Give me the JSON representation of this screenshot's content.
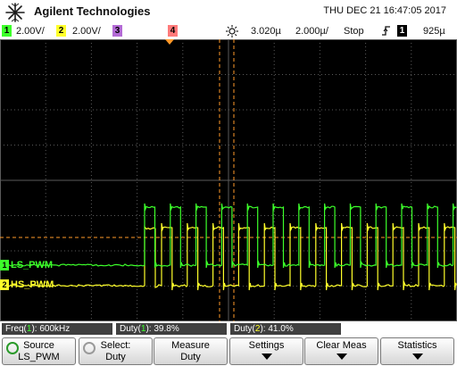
{
  "header": {
    "brand": "Agilent Technologies",
    "datetime": "THU DEC 21 16:47:05 2017"
  },
  "status": {
    "ch1_number": "1",
    "ch1_scale": "2.00V/",
    "ch2_number": "2",
    "ch2_scale": "2.00V/",
    "ch3_number": "3",
    "ch4_number": "4",
    "time_delay": "3.020µ",
    "time_scale": "2.000µ/",
    "run_state": "Stop",
    "trigger_source": "1",
    "trigger_level": "925µ"
  },
  "channels": {
    "ch1_name": "LS_PWM",
    "ch2_name": "HS_PWM",
    "ch1_color": "#3cff2a",
    "ch2_color": "#ffff2a",
    "ch4_color": "#ff9a2a"
  },
  "measurements": {
    "freq_prefix": "Freq(",
    "freq_channel": "1",
    "freq_suffix": "): 600kHz",
    "duty1_prefix": "Duty(",
    "duty1_channel": "1",
    "duty1_suffix": "): 39.8%",
    "duty2_prefix": "Duty(",
    "duty2_channel": "2",
    "duty2_suffix": "): 41.0%"
  },
  "softkeys": {
    "source_line1": "Source",
    "source_line2": "LS_PWM",
    "select_line1": "Select:",
    "select_line2": "Duty",
    "measure_line1": "Measure",
    "measure_line2": "Duty",
    "settings": "Settings",
    "clear_meas": "Clear Meas",
    "statistics": "Statistics"
  }
}
